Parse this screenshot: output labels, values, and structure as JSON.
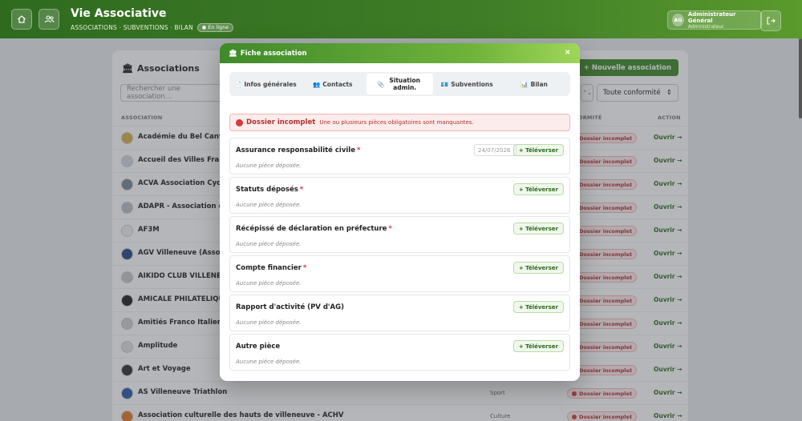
{
  "header": {
    "title": "Vie Associative",
    "subtitle": "ASSOCIATIONS · SUBVENTIONS · BILAN",
    "online_badge": "● En ligne",
    "user_initials": "AG",
    "user_name": "Administrateur Général",
    "user_role": "Administrateur"
  },
  "panel": {
    "title": "Associations",
    "new_button": "+ Nouvelle association",
    "search_placeholder": "Rechercher une association...",
    "filter_small": "⌃⌄",
    "filter_conformity": "Toute conformité",
    "col_association": "ASSOCIATION",
    "col_conformity": "ORMITÉ",
    "col_action": "ACTION",
    "rows": [
      {
        "name": "Académie du Bel Canto",
        "category": "",
        "status": "Dossier incomplet",
        "action": "Ouvrir →"
      },
      {
        "name": "Accueil des Villes Français",
        "category": "",
        "status": "Dossier incomplet",
        "action": "Ouvrir →"
      },
      {
        "name": "ACVA Association Cycloto",
        "category": "",
        "status": "Dossier incomplet",
        "action": "Ouvrir →"
      },
      {
        "name": "ADAPR - Association de d",
        "category": "",
        "status": "Dossier incomplet",
        "action": "Ouvrir →"
      },
      {
        "name": "AF3M",
        "category": "",
        "status": "Dossier incomplet",
        "action": "Ouvrir →"
      },
      {
        "name": "AGV Villeneuve (Associati",
        "category": "",
        "status": "Dossier incomplet",
        "action": "Ouvrir →"
      },
      {
        "name": "AIKIDO CLUB VILLENEUV",
        "category": "",
        "status": "Dossier incomplet",
        "action": "Ouvrir →"
      },
      {
        "name": "AMICALE PHILATELIQUE D",
        "category": "",
        "status": "Dossier incomplet",
        "action": "Ouvrir →"
      },
      {
        "name": "Amitiés Franco Italiennes",
        "category": "",
        "status": "Dossier incomplet",
        "action": "Ouvrir →"
      },
      {
        "name": "Amplitude",
        "category": "",
        "status": "Dossier incomplet",
        "action": "Ouvrir →"
      },
      {
        "name": "Art et Voyage",
        "category": "",
        "status": "Dossier incomplet",
        "action": "Ouvrir →"
      },
      {
        "name": "AS Villeneuve Triathlon",
        "category": "Sport",
        "status": "Dossier incomplet",
        "action": "Ouvrir →"
      },
      {
        "name": "Association culturelle des hauts de villeneuve - ACHV",
        "category": "Culture",
        "status": "Dossier incomplet",
        "action": "Ouvrir →"
      }
    ]
  },
  "modal": {
    "title": "Fiche association",
    "close": "×",
    "tabs": [
      {
        "icon": "📄",
        "label": "Infos générales"
      },
      {
        "icon": "👥",
        "label": "Contacts"
      },
      {
        "icon": "📎",
        "label": "Situation admin."
      },
      {
        "icon": "💶",
        "label": "Subventions"
      },
      {
        "icon": "📊",
        "label": "Bilan"
      }
    ],
    "alert_title": "Dossier incomplet",
    "alert_message": "Une ou plusieurs pièces obligatoires sont manquantes.",
    "upload_label": "+ Téléverser",
    "documents": [
      {
        "title": "Assurance responsabilité civile",
        "required": "*",
        "subtitle": "Aucune pièce déposée.",
        "date": "24/07/2026"
      },
      {
        "title": "Statuts déposés",
        "required": "*",
        "subtitle": "Aucune pièce déposée.",
        "date": ""
      },
      {
        "title": "Récépissé de déclaration en préfecture",
        "required": "*",
        "subtitle": "Aucune pièce déposée.",
        "date": ""
      },
      {
        "title": "Compte financier",
        "required": "*",
        "subtitle": "Aucune pièce déposée.",
        "date": ""
      },
      {
        "title": "Rapport d'activité (PV d'AG)",
        "required": "",
        "subtitle": "Aucune pièce déposée.",
        "date": ""
      },
      {
        "title": "Autre pièce",
        "required": "",
        "subtitle": "Aucune pièce déposée.",
        "date": ""
      }
    ]
  }
}
